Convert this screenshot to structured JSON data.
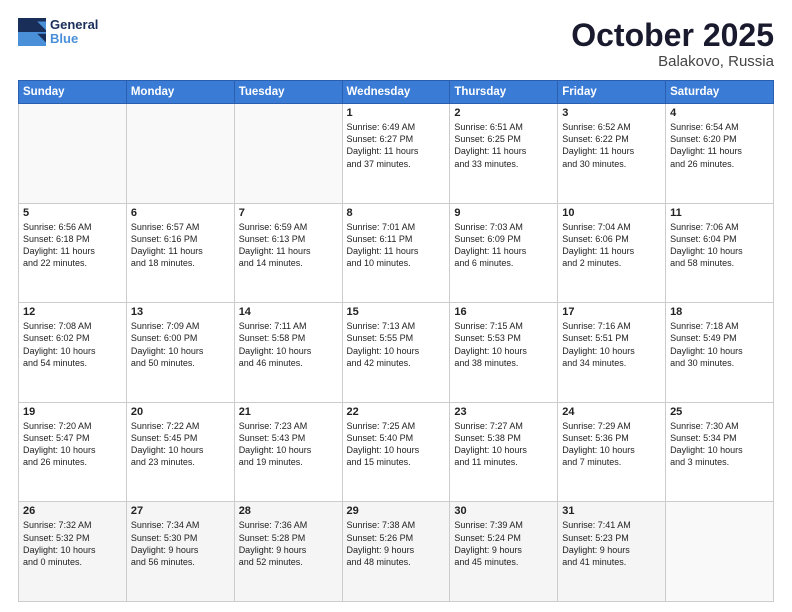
{
  "header": {
    "logo_general": "General",
    "logo_blue": "Blue",
    "month": "October 2025",
    "location": "Balakovo, Russia"
  },
  "days_of_week": [
    "Sunday",
    "Monday",
    "Tuesday",
    "Wednesday",
    "Thursday",
    "Friday",
    "Saturday"
  ],
  "weeks": [
    [
      {
        "day": "",
        "content": ""
      },
      {
        "day": "",
        "content": ""
      },
      {
        "day": "",
        "content": ""
      },
      {
        "day": "1",
        "content": "Sunrise: 6:49 AM\nSunset: 6:27 PM\nDaylight: 11 hours\nand 37 minutes."
      },
      {
        "day": "2",
        "content": "Sunrise: 6:51 AM\nSunset: 6:25 PM\nDaylight: 11 hours\nand 33 minutes."
      },
      {
        "day": "3",
        "content": "Sunrise: 6:52 AM\nSunset: 6:22 PM\nDaylight: 11 hours\nand 30 minutes."
      },
      {
        "day": "4",
        "content": "Sunrise: 6:54 AM\nSunset: 6:20 PM\nDaylight: 11 hours\nand 26 minutes."
      }
    ],
    [
      {
        "day": "5",
        "content": "Sunrise: 6:56 AM\nSunset: 6:18 PM\nDaylight: 11 hours\nand 22 minutes."
      },
      {
        "day": "6",
        "content": "Sunrise: 6:57 AM\nSunset: 6:16 PM\nDaylight: 11 hours\nand 18 minutes."
      },
      {
        "day": "7",
        "content": "Sunrise: 6:59 AM\nSunset: 6:13 PM\nDaylight: 11 hours\nand 14 minutes."
      },
      {
        "day": "8",
        "content": "Sunrise: 7:01 AM\nSunset: 6:11 PM\nDaylight: 11 hours\nand 10 minutes."
      },
      {
        "day": "9",
        "content": "Sunrise: 7:03 AM\nSunset: 6:09 PM\nDaylight: 11 hours\nand 6 minutes."
      },
      {
        "day": "10",
        "content": "Sunrise: 7:04 AM\nSunset: 6:06 PM\nDaylight: 11 hours\nand 2 minutes."
      },
      {
        "day": "11",
        "content": "Sunrise: 7:06 AM\nSunset: 6:04 PM\nDaylight: 10 hours\nand 58 minutes."
      }
    ],
    [
      {
        "day": "12",
        "content": "Sunrise: 7:08 AM\nSunset: 6:02 PM\nDaylight: 10 hours\nand 54 minutes."
      },
      {
        "day": "13",
        "content": "Sunrise: 7:09 AM\nSunset: 6:00 PM\nDaylight: 10 hours\nand 50 minutes."
      },
      {
        "day": "14",
        "content": "Sunrise: 7:11 AM\nSunset: 5:58 PM\nDaylight: 10 hours\nand 46 minutes."
      },
      {
        "day": "15",
        "content": "Sunrise: 7:13 AM\nSunset: 5:55 PM\nDaylight: 10 hours\nand 42 minutes."
      },
      {
        "day": "16",
        "content": "Sunrise: 7:15 AM\nSunset: 5:53 PM\nDaylight: 10 hours\nand 38 minutes."
      },
      {
        "day": "17",
        "content": "Sunrise: 7:16 AM\nSunset: 5:51 PM\nDaylight: 10 hours\nand 34 minutes."
      },
      {
        "day": "18",
        "content": "Sunrise: 7:18 AM\nSunset: 5:49 PM\nDaylight: 10 hours\nand 30 minutes."
      }
    ],
    [
      {
        "day": "19",
        "content": "Sunrise: 7:20 AM\nSunset: 5:47 PM\nDaylight: 10 hours\nand 26 minutes."
      },
      {
        "day": "20",
        "content": "Sunrise: 7:22 AM\nSunset: 5:45 PM\nDaylight: 10 hours\nand 23 minutes."
      },
      {
        "day": "21",
        "content": "Sunrise: 7:23 AM\nSunset: 5:43 PM\nDaylight: 10 hours\nand 19 minutes."
      },
      {
        "day": "22",
        "content": "Sunrise: 7:25 AM\nSunset: 5:40 PM\nDaylight: 10 hours\nand 15 minutes."
      },
      {
        "day": "23",
        "content": "Sunrise: 7:27 AM\nSunset: 5:38 PM\nDaylight: 10 hours\nand 11 minutes."
      },
      {
        "day": "24",
        "content": "Sunrise: 7:29 AM\nSunset: 5:36 PM\nDaylight: 10 hours\nand 7 minutes."
      },
      {
        "day": "25",
        "content": "Sunrise: 7:30 AM\nSunset: 5:34 PM\nDaylight: 10 hours\nand 3 minutes."
      }
    ],
    [
      {
        "day": "26",
        "content": "Sunrise: 7:32 AM\nSunset: 5:32 PM\nDaylight: 10 hours\nand 0 minutes."
      },
      {
        "day": "27",
        "content": "Sunrise: 7:34 AM\nSunset: 5:30 PM\nDaylight: 9 hours\nand 56 minutes."
      },
      {
        "day": "28",
        "content": "Sunrise: 7:36 AM\nSunset: 5:28 PM\nDaylight: 9 hours\nand 52 minutes."
      },
      {
        "day": "29",
        "content": "Sunrise: 7:38 AM\nSunset: 5:26 PM\nDaylight: 9 hours\nand 48 minutes."
      },
      {
        "day": "30",
        "content": "Sunrise: 7:39 AM\nSunset: 5:24 PM\nDaylight: 9 hours\nand 45 minutes."
      },
      {
        "day": "31",
        "content": "Sunrise: 7:41 AM\nSunset: 5:23 PM\nDaylight: 9 hours\nand 41 minutes."
      },
      {
        "day": "",
        "content": ""
      }
    ]
  ]
}
